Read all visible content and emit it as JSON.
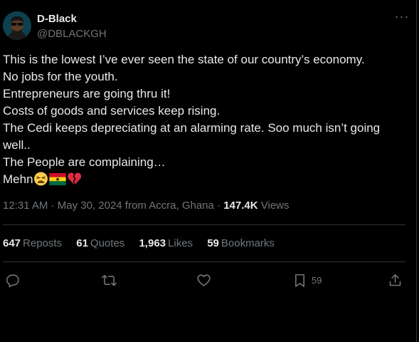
{
  "author": {
    "name": "D-Black",
    "handle": "@DBLACKGH"
  },
  "more_glyph": "···",
  "tweet": {
    "lines": [
      "This is the lowest I’ve ever seen the state of our country’s economy.",
      "No jobs for the youth.",
      "Entrepreneurs are going thru it!",
      "Costs of goods and services keep rising.",
      "The Cedi keeps depreciating at an alarming rate. Soo much isn’t going well..",
      "The People are complaining…",
      "Mehn"
    ],
    "emojis": [
      "weary-face-emoji",
      "ghana-flag-emoji",
      "broken-heart-emoji"
    ]
  },
  "meta": {
    "time": "12:31 AM",
    "sep1": " · ",
    "date": "May 30, 2024",
    "location": " from Accra, Ghana",
    "sep2": " · ",
    "views_count": "147.4K",
    "views_label": " Views"
  },
  "stats": {
    "reposts_count": "647",
    "reposts_label": "Reposts",
    "quotes_count": "61",
    "quotes_label": "Quotes",
    "likes_count": "1,963",
    "likes_label": "Likes",
    "bookmarks_count": "59",
    "bookmarks_label": "Bookmarks"
  },
  "actions": {
    "reply_icon": "reply-icon",
    "repost_icon": "repost-icon",
    "like_icon": "heart-icon",
    "bookmark_icon": "bookmark-icon",
    "bookmark_count": "59",
    "share_icon": "share-icon"
  },
  "colors": {
    "background": "#000000",
    "text": "#e7e9ea",
    "muted": "#71767b",
    "divider": "#2f3336"
  }
}
